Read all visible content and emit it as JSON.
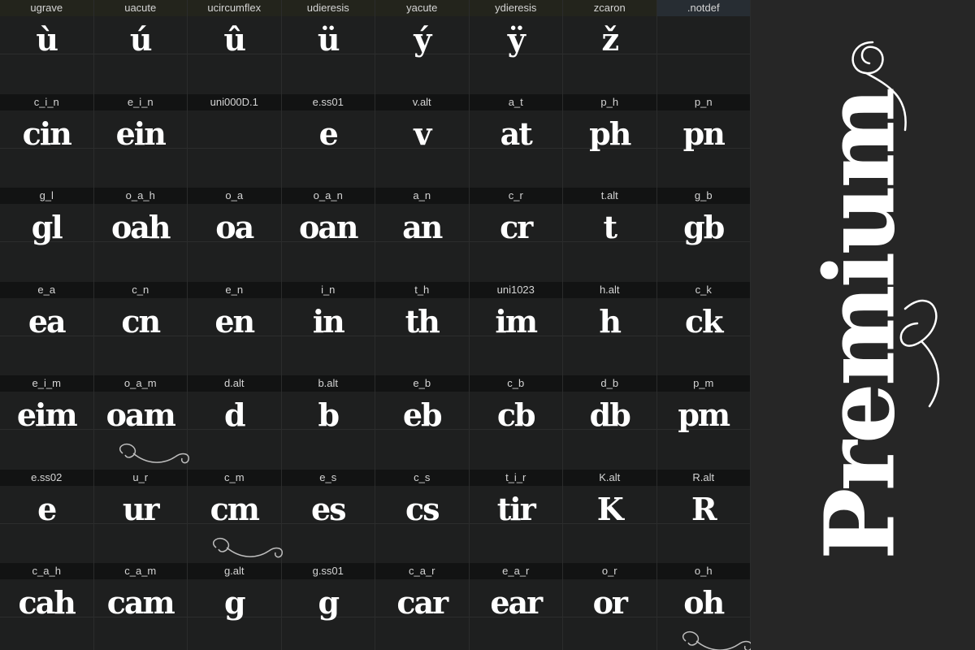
{
  "grid": {
    "rows": [
      [
        {
          "name": "ugrave",
          "char": "ù"
        },
        {
          "name": "uacute",
          "char": "ú"
        },
        {
          "name": "ucircumflex",
          "char": "û"
        },
        {
          "name": "udieresis",
          "char": "ü"
        },
        {
          "name": "yacute",
          "char": "ý"
        },
        {
          "name": "ydieresis",
          "char": "ÿ"
        },
        {
          "name": "zcaron",
          "char": "ž"
        },
        {
          "name": ".notdef",
          "char": ""
        }
      ],
      [
        {
          "name": "c_i_n",
          "char": "cin"
        },
        {
          "name": "e_i_n",
          "char": "ein"
        },
        {
          "name": "uni000D.1",
          "char": ""
        },
        {
          "name": "e.ss01",
          "char": "e"
        },
        {
          "name": "v.alt",
          "char": "v"
        },
        {
          "name": "a_t",
          "char": "at"
        },
        {
          "name": "p_h",
          "char": "ph"
        },
        {
          "name": "p_n",
          "char": "pn"
        }
      ],
      [
        {
          "name": "g_l",
          "char": "gl"
        },
        {
          "name": "o_a_h",
          "char": "oah"
        },
        {
          "name": "o_a",
          "char": "oa"
        },
        {
          "name": "o_a_n",
          "char": "oan"
        },
        {
          "name": "a_n",
          "char": "an"
        },
        {
          "name": "c_r",
          "char": "cr"
        },
        {
          "name": "t.alt",
          "char": "t"
        },
        {
          "name": "g_b",
          "char": "gb"
        }
      ],
      [
        {
          "name": "e_a",
          "char": "ea"
        },
        {
          "name": "c_n",
          "char": "cn"
        },
        {
          "name": "e_n",
          "char": "en"
        },
        {
          "name": "i_n",
          "char": "in"
        },
        {
          "name": "t_h",
          "char": "th"
        },
        {
          "name": "uni1023",
          "char": "im"
        },
        {
          "name": "h.alt",
          "char": "h"
        },
        {
          "name": "c_k",
          "char": "ck"
        }
      ],
      [
        {
          "name": "e_i_m",
          "char": "eim"
        },
        {
          "name": "o_a_m",
          "char": "oam"
        },
        {
          "name": "d.alt",
          "char": "d"
        },
        {
          "name": "b.alt",
          "char": "b"
        },
        {
          "name": "e_b",
          "char": "eb"
        },
        {
          "name": "c_b",
          "char": "cb"
        },
        {
          "name": "d_b",
          "char": "db"
        },
        {
          "name": "p_m",
          "char": "pm"
        }
      ],
      [
        {
          "name": "e.ss02",
          "char": "e"
        },
        {
          "name": "u_r",
          "char": "ur"
        },
        {
          "name": "c_m",
          "char": "cm"
        },
        {
          "name": "e_s",
          "char": "es"
        },
        {
          "name": "c_s",
          "char": "cs"
        },
        {
          "name": "t_i_r",
          "char": "tir"
        },
        {
          "name": "K.alt",
          "char": "K"
        },
        {
          "name": "R.alt",
          "char": "R"
        }
      ],
      [
        {
          "name": "c_a_h",
          "char": "cah"
        },
        {
          "name": "c_a_m",
          "char": "cam"
        },
        {
          "name": "g.alt",
          "char": "g"
        },
        {
          "name": "g.ss01",
          "char": "g"
        },
        {
          "name": "c_a_r",
          "char": "car"
        },
        {
          "name": "e_a_r",
          "char": "ear"
        },
        {
          "name": "o_r",
          "char": "or"
        },
        {
          "name": "o_h",
          "char": "oh"
        }
      ]
    ]
  },
  "title": {
    "text": "Premium"
  },
  "colors": {
    "background": "#262626",
    "cell": "#1e1f1f",
    "label_bar": "#121313",
    "highlight_bar": "#23241c",
    "selected_bar": "#272d33",
    "glyph": "#ffffff",
    "label": "#d5d5d5"
  }
}
